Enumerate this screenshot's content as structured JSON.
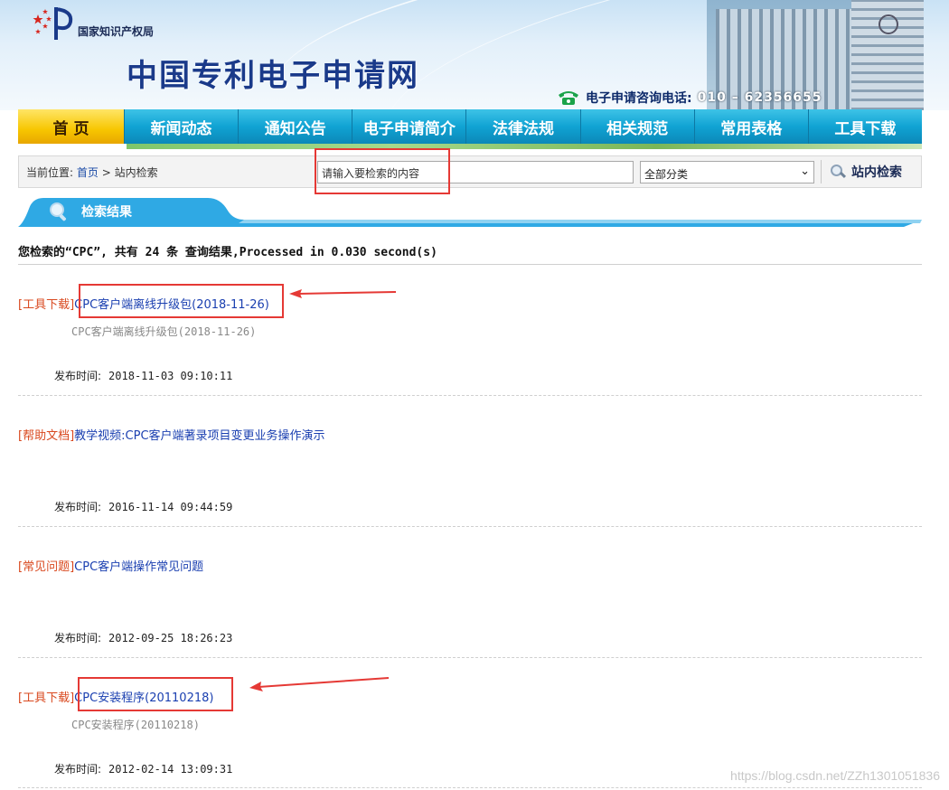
{
  "header": {
    "org_name": "国家知识产权局",
    "site_title": "中国专利电子申请网",
    "phone_label": "电子申请咨询电话:",
    "phone_number": "010 – 62356655"
  },
  "nav": {
    "items": [
      "首 页",
      "新闻动态",
      "通知公告",
      "电子申请简介",
      "法律法规",
      "相关规范",
      "常用表格",
      "工具下载"
    ]
  },
  "breadcrumb": {
    "prefix": "当前位置:",
    "home": "首页",
    "sep": ">",
    "current": "站内检索"
  },
  "search": {
    "placeholder": "请输入要检索的内容",
    "category_selected": "全部分类",
    "button_label": "站内检索"
  },
  "results_tab": {
    "label": "检索结果"
  },
  "summary": "您检索的“CPC”, 共有 24 条 查询结果,Processed in 0.030 second(s)",
  "results": [
    {
      "category": "[工具下载]",
      "title": "CPC客户端离线升级包(2018-11-26)",
      "description": "CPC客户端离线升级包(2018-11-26)",
      "date_label": "发布时间:",
      "date": "2018-11-03 09:10:11"
    },
    {
      "category": "[帮助文档]",
      "title": "教学视频:CPC客户端著录项目变更业务操作演示",
      "description": "",
      "date_label": "发布时间:",
      "date": "2016-11-14 09:44:59"
    },
    {
      "category": "[常见问题]",
      "title": "CPC客户端操作常见问题",
      "description": "",
      "date_label": "发布时间:",
      "date": "2012-09-25 18:26:23"
    },
    {
      "category": "[工具下载]",
      "title": "CPC安装程序(20110218)",
      "description": "CPC安装程序(20110218)",
      "date_label": "发布时间:",
      "date": "2012-02-14 13:09:31"
    }
  ],
  "watermark": "https://blog.csdn.net/ZZh1301051836",
  "colors": {
    "nav_blue": "#10a3d3",
    "nav_home_yellow": "#f7c600",
    "category_red": "#d9481e",
    "link_blue": "#1a3fb0",
    "annotation_red": "#e53935"
  }
}
